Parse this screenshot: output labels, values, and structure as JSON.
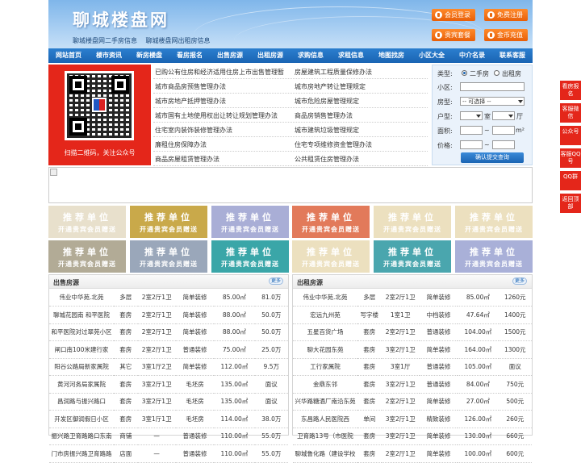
{
  "header": {
    "title": "聊城楼盘网",
    "subtitle_1": "聊城楼盘网二手房信息",
    "subtitle_2": "聊城楼盘网出租房信息",
    "buttons": [
      "会员登录",
      "免费注册",
      "贵宾套餐",
      "金币充值"
    ]
  },
  "nav": [
    "网站首页",
    "楼市资讯",
    "新房楼盘",
    "看房报名",
    "出售房源",
    "出租房源",
    "求购信息",
    "求租信息",
    "地图找房",
    "小区大全",
    "中介名录",
    "联系客服"
  ],
  "qr": {
    "caption": "扫描二维码，关注公众号"
  },
  "links": {
    "left": [
      "已购公有住房和经济适用住房上市出售管理暂",
      "城市商品房预售管理办法",
      "城市房地产抵押管理办法",
      "城市国有土地使用权出让转让规划管理办法",
      "住宅室内装饰装修管理办法",
      "廉租住房保障办法",
      "商品房屋租赁管理办法"
    ],
    "right": [
      "房屋建筑工程质量保修办法",
      "城市房地产转让管理规定",
      "城市危险房屋管理规定",
      "商品房销售管理办法",
      "城市建筑垃圾管理规定",
      "住宅专项维修资金管理办法",
      "公共租赁住房管理办法"
    ]
  },
  "search": {
    "type_label": "类型:",
    "type_options": [
      "二手房",
      "出租房"
    ],
    "community_label": "小区:",
    "house_type_label": "房型:",
    "house_type_value": "-- 可选择 --",
    "layout_label": "户型:",
    "room_unit": "室",
    "hall_unit": "厅",
    "area_label": "面积:",
    "area_unit": "m²",
    "price_label": "价格:",
    "range_sep": "~",
    "submit": "确认提交查询"
  },
  "promo": {
    "line1": "推荐单位",
    "line2": "开通贵宾会员赠送",
    "colors": [
      "#e8e0cc",
      "#c9a94a",
      "#a9aed6",
      "#e27a5a",
      "#ece0bf",
      "#ece0bf",
      "#b2ab96",
      "#9aa7ba",
      "#3aa6a8",
      "#ece0bf",
      "#4aa6ae",
      "#a9b0d8"
    ]
  },
  "sale": {
    "title": "出售房源",
    "more": "更多",
    "rows": [
      [
        "伟业中华苑.北苑",
        "多层",
        "2室2厅1卫",
        "简单装修",
        "85.00㎡",
        "81.0万"
      ],
      [
        "聊城花园南 和平医院",
        "套房",
        "2室2厅1卫",
        "简单装修",
        "88.00㎡",
        "50.0万"
      ],
      [
        "和平医院对过翠苑小区",
        "套房",
        "2室2厅1卫",
        "简单装修",
        "88.00㎡",
        "50.0万"
      ],
      [
        "闸口南100米建行家",
        "套房",
        "2室2厅1卫",
        "普通装修",
        "75.00㎡",
        "25.0万"
      ],
      [
        "阳谷公路局新家属院",
        "其它",
        "3室1厅2卫",
        "简单装修",
        "112.00㎡",
        "9.5万"
      ],
      [
        "黄河河务局家属院",
        "套房",
        "3室2厅1卫",
        "毛坯房",
        "135.00㎡",
        "面议"
      ],
      [
        "昌润路与振兴路口",
        "套房",
        "3室2厅1卫",
        "毛坯房",
        "135.00㎡",
        "面议"
      ],
      [
        "开发区御润假日小区",
        "套房",
        "3室1厅1卫",
        "毛坯房",
        "114.00㎡",
        "38.0万"
      ],
      [
        "振兴路卫育路路口东南",
        "商铺",
        "—",
        "普通装修",
        "110.00㎡",
        "55.0万"
      ],
      [
        "门市房振兴路卫育路路",
        "店面",
        "—",
        "普通装修",
        "110.00㎡",
        "55.0万"
      ]
    ]
  },
  "rent": {
    "title": "出租房源",
    "more": "更多",
    "rows": [
      [
        "伟业中华苑.北苑",
        "多层",
        "2室2厅1卫",
        "简单装修",
        "85.00㎡",
        "1260元"
      ],
      [
        "宏远九州苑",
        "写字楼",
        "1室1卫",
        "中档装修",
        "47.64㎡",
        "1400元"
      ],
      [
        "五星百货广场",
        "套房",
        "2室2厅1卫",
        "普通装修",
        "104.00㎡",
        "1500元"
      ],
      [
        "聊大花园东苑",
        "套房",
        "3室2厅1卫",
        "简单装修",
        "164.00㎡",
        "1300元"
      ],
      [
        "工行家属院",
        "套房",
        "3室1厅",
        "普通装修",
        "105.00㎡",
        "面议"
      ],
      [
        "金鼎东邻",
        "套房",
        "3室2厅1卫",
        "普通装修",
        "84.00㎡",
        "750元"
      ],
      [
        "兴华路糖酒厂南沿东苑",
        "套房",
        "2室2厅1卫",
        "简单装修",
        "27.00㎡",
        "500元"
      ],
      [
        "东昌路人民医院西",
        "单间",
        "3室2厅1卫",
        "精致装修",
        "126.00㎡",
        "260元"
      ],
      [
        "卫育路13号（市医院",
        "套房",
        "3室2厅1卫",
        "简单装修",
        "130.00㎡",
        "660元"
      ],
      [
        "聊城鲁化路（建设学校",
        "套房",
        "2室2厅1卫",
        "简单装修",
        "100.00㎡",
        "600元"
      ]
    ]
  },
  "float": [
    "看房报名",
    "客服微信",
    "公众号",
    "客服QQ号",
    "QQ群",
    "返回顶部"
  ]
}
